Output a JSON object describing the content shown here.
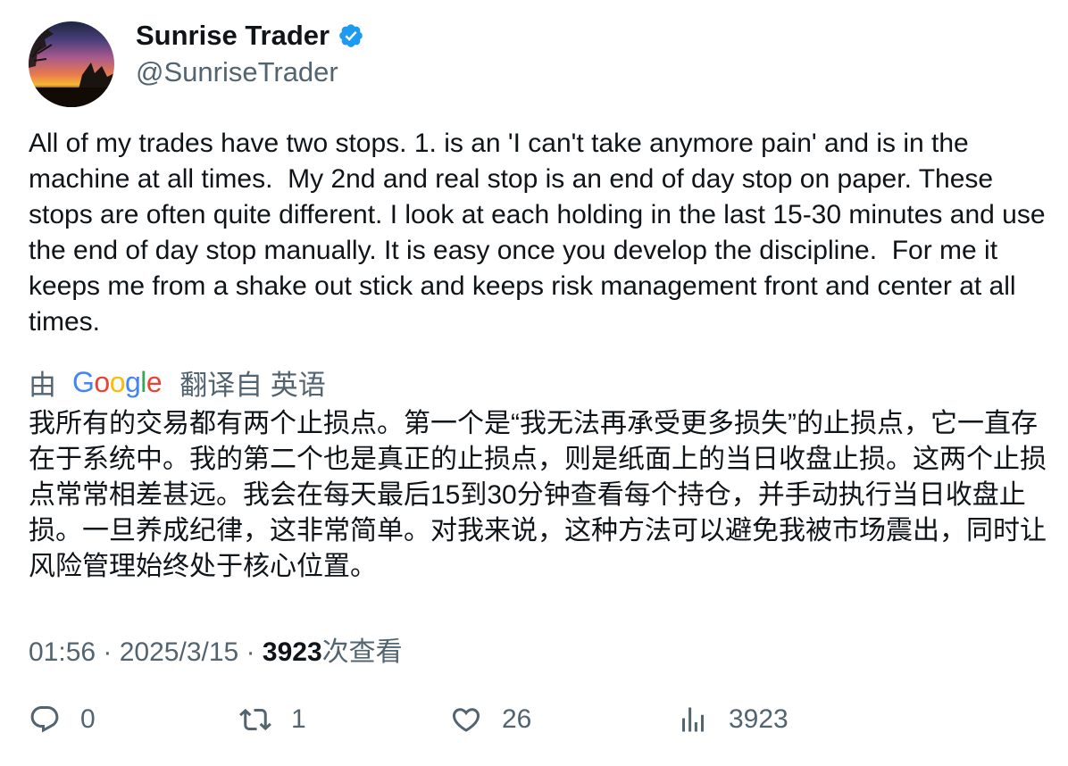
{
  "user": {
    "display_name": "Sunrise Trader",
    "handle": "@SunriseTrader",
    "verified": true
  },
  "tweet": {
    "text": "All of my trades have two stops. 1. is an 'I can't take anymore pain' and is in the machine at all times.  My 2nd and real stop is an end of day stop on paper. These stops are often quite different. I look at each holding in the last 15-30 minutes and use the end of day stop manually. It is easy once you develop the discipline.  For me it keeps me from a shake out stick and keeps risk management front and center at all times."
  },
  "translation": {
    "prefix": "由",
    "provider": "Google",
    "suffix": "翻译自 英语",
    "text": "我所有的交易都有两个止损点。第一个是“我无法再承受更多损失”的止损点，它一直存在于系统中。我的第二个也是真正的止损点，则是纸面上的当日收盘止损。这两个止损点常常相差甚远。我会在每天最后15到30分钟查看每个持仓，并手动执行当日收盘止损。一旦养成纪律，这非常简单。对我来说，这种方法可以避免我被市场震出，同时让风险管理始终处于核心位置。"
  },
  "meta": {
    "time": "01:56",
    "separator": "·",
    "date": "2025/3/15",
    "views": "3923",
    "views_label": "次查看"
  },
  "actions": {
    "replies": "0",
    "retweets": "1",
    "likes": "26",
    "views": "3923"
  },
  "colors": {
    "text": "#0f1419",
    "secondary": "#536471",
    "verified": "#1d9bf0"
  },
  "icons": [
    "verified-badge-icon",
    "reply-icon",
    "retweet-icon",
    "like-icon",
    "views-icon"
  ]
}
